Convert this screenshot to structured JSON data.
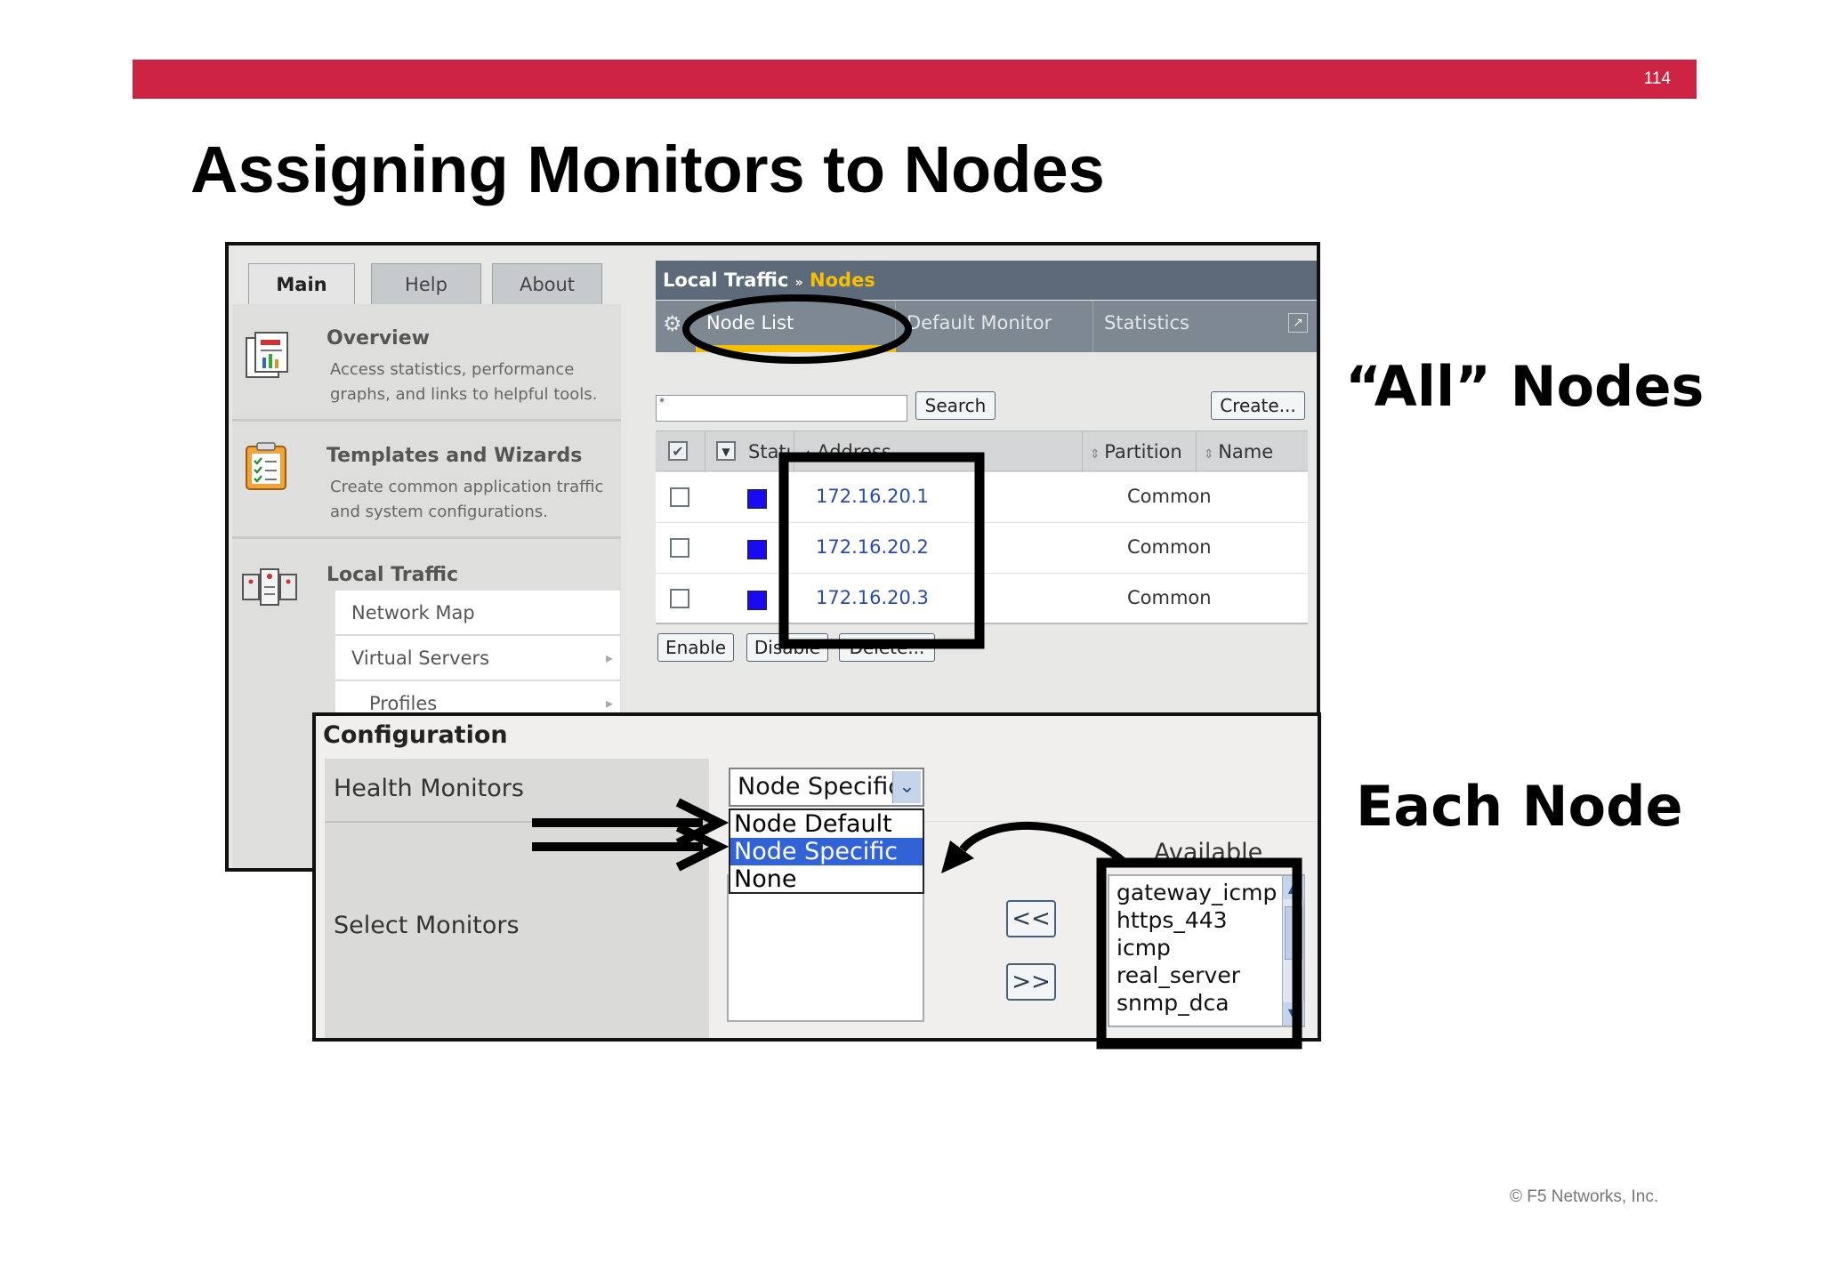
{
  "slide": {
    "page_number": "114",
    "title": "Assigning Monitors to Nodes",
    "label_all_nodes": "“All” Nodes",
    "label_each_node": "Each Node",
    "copyright": "© F5 Networks, Inc."
  },
  "colors": {
    "header_bar": "#cc2442",
    "highlight": "#f5c000",
    "link": "#2b4ba8",
    "status_available": "#1a0af0"
  },
  "nav_tabs": [
    "Main",
    "Help",
    "About"
  ],
  "sidebar": {
    "overview": {
      "title": "Overview",
      "desc": "Access statistics, performance graphs, and links to helpful tools."
    },
    "templates": {
      "title": "Templates and Wizards",
      "desc": "Create common application traffic and system configurations."
    },
    "local_traffic": {
      "title": "Local Traffic",
      "items": [
        "Network Map",
        "Virtual Servers",
        "Profiles"
      ]
    }
  },
  "content": {
    "breadcrumb_section": "Local Traffic",
    "breadcrumb_sep": "»",
    "breadcrumb_page": "Nodes",
    "tabs": [
      "Node List",
      "Default Monitor",
      "Statistics"
    ],
    "search_value": "*",
    "search_button": "Search",
    "create_button": "Create...",
    "columns": [
      "Status",
      "Address",
      "Partition",
      "Name"
    ],
    "rows": [
      {
        "address": "172.16.20.1",
        "partition": "Common"
      },
      {
        "address": "172.16.20.2",
        "partition": "Common"
      },
      {
        "address": "172.16.20.3",
        "partition": "Common"
      }
    ],
    "actions": [
      "Enable",
      "Disable",
      "Delete..."
    ]
  },
  "configuration": {
    "title": "Configuration",
    "health_monitors_label": "Health Monitors",
    "select_monitors_label": "Select Monitors",
    "selected_option": "Node Specific",
    "options": [
      "Node Default",
      "Node Specific",
      "None"
    ],
    "move_left": "<<",
    "move_right": ">>",
    "available_label": "Available",
    "available": [
      "gateway_icmp",
      "https_443",
      "icmp",
      "real_server",
      "snmp_dca"
    ]
  }
}
